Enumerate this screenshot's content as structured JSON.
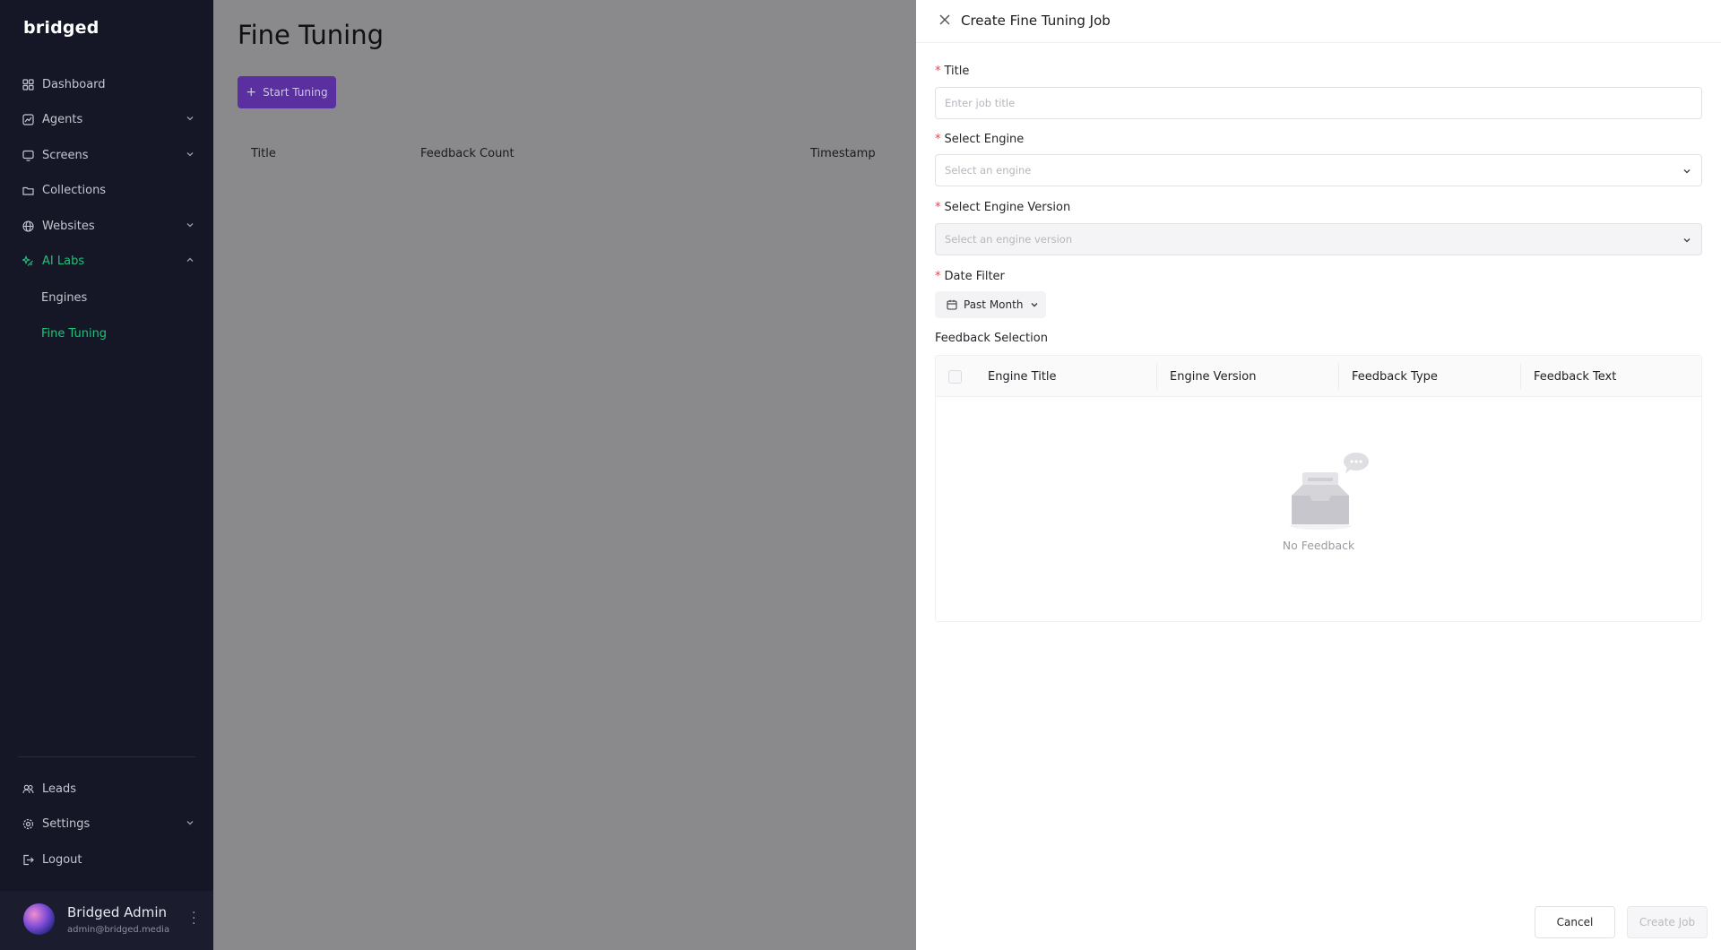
{
  "sidebar": {
    "logo": "bridged",
    "items": [
      {
        "label": "Dashboard",
        "icon": "grid-icon"
      },
      {
        "label": "Agents",
        "icon": "chart-icon"
      },
      {
        "label": "Screens",
        "icon": "monitor-icon"
      },
      {
        "label": "Collections",
        "icon": "folder-icon"
      },
      {
        "label": "Websites",
        "icon": "globe-icon"
      },
      {
        "label": "AI Labs",
        "icon": "sparkle-icon"
      }
    ],
    "subitems": [
      {
        "label": "Engines"
      },
      {
        "label": "Fine Tuning"
      }
    ],
    "bottom_items": [
      {
        "label": "Leads",
        "icon": "users-icon"
      },
      {
        "label": "Settings",
        "icon": "gear-icon"
      },
      {
        "label": "Logout",
        "icon": "logout-icon"
      }
    ],
    "profile": {
      "name": "Bridged Admin",
      "email": "admin@bridged.media"
    },
    "accent": "#22c07a"
  },
  "main": {
    "title": "Fine Tuning",
    "start_button": "Start Tuning",
    "columns": [
      "Title",
      "Feedback Count",
      "Timestamp"
    ]
  },
  "drawer": {
    "title": "Create Fine Tuning Job",
    "fields": {
      "title_label": "Title",
      "title_placeholder": "Enter job title",
      "engine_label": "Select Engine",
      "engine_placeholder": "Select an engine",
      "version_label": "Select Engine Version",
      "version_placeholder": "Select an engine version",
      "date_label": "Date Filter",
      "date_value": "Past Month"
    },
    "feedback": {
      "label": "Feedback Selection",
      "columns": [
        "Engine Title",
        "Engine Version",
        "Feedback Type",
        "Feedback Text"
      ],
      "empty_text": "No Feedback"
    },
    "cancel_label": "Cancel",
    "create_label": "Create Job"
  }
}
